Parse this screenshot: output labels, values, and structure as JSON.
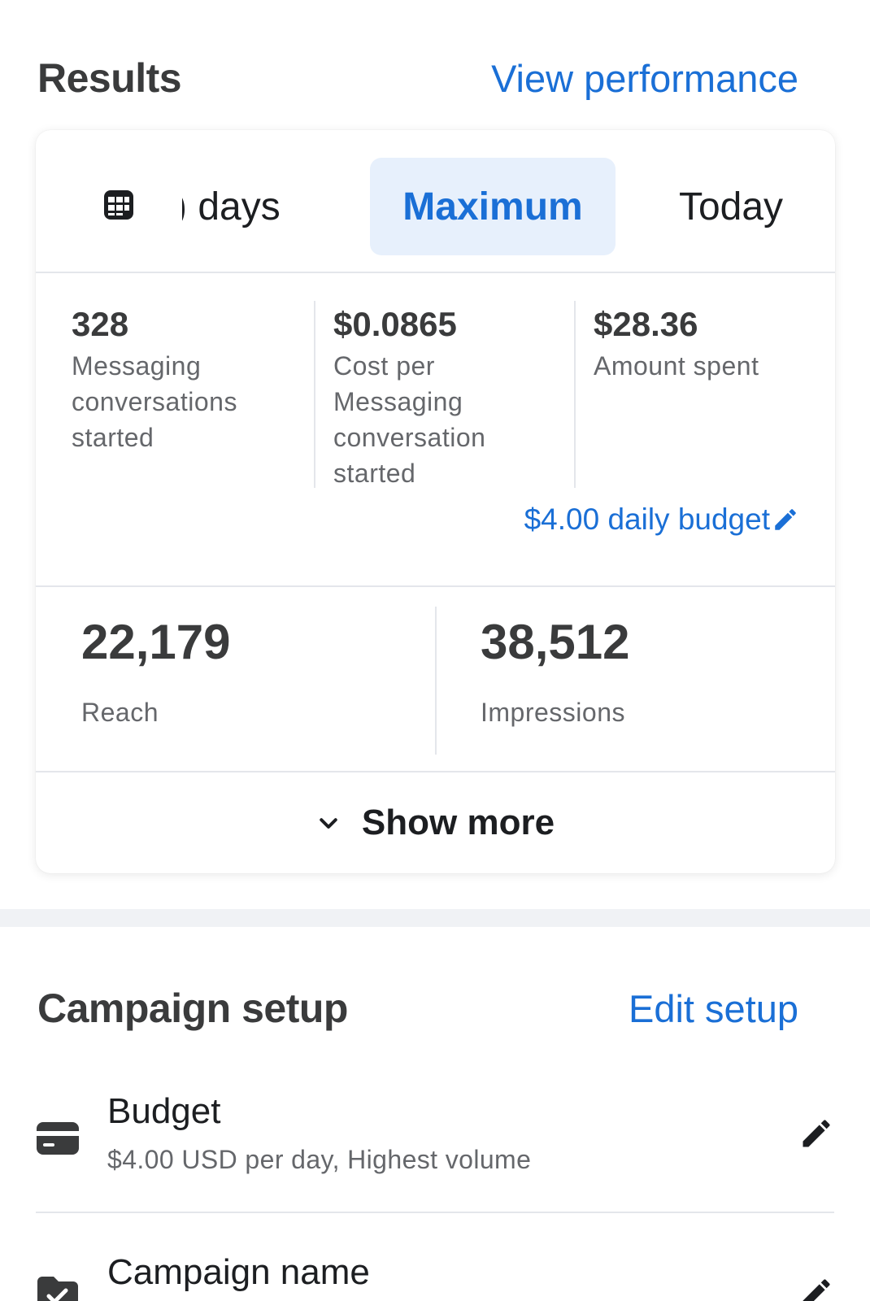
{
  "results": {
    "title": "Results",
    "view_performance": "View performance"
  },
  "date_tabs": {
    "partial_label": ") days",
    "active_label": "Maximum",
    "today_label": "Today"
  },
  "metrics": [
    {
      "value": "328",
      "label": "Messaging conversations started"
    },
    {
      "value": "$0.0865",
      "label": "Cost per Messaging conversation started"
    },
    {
      "value": "$28.36",
      "label": "Amount spent"
    }
  ],
  "budget_link": "$4.00 daily budget",
  "reach": {
    "value": "22,179",
    "label": "Reach"
  },
  "impressions": {
    "value": "38,512",
    "label": "Impressions"
  },
  "show_more": "Show more",
  "setup": {
    "title": "Campaign setup",
    "edit_setup": "Edit setup",
    "budget": {
      "title": "Budget",
      "subtitle": "$4.00 USD per day, Highest volume"
    },
    "campaign_name": {
      "title": "Campaign name"
    }
  },
  "colors": {
    "accent": "#1a6fd6",
    "active_tab_bg": "#e7f0fc",
    "divider": "#e4e6eb",
    "secondary_text": "#65676b"
  }
}
